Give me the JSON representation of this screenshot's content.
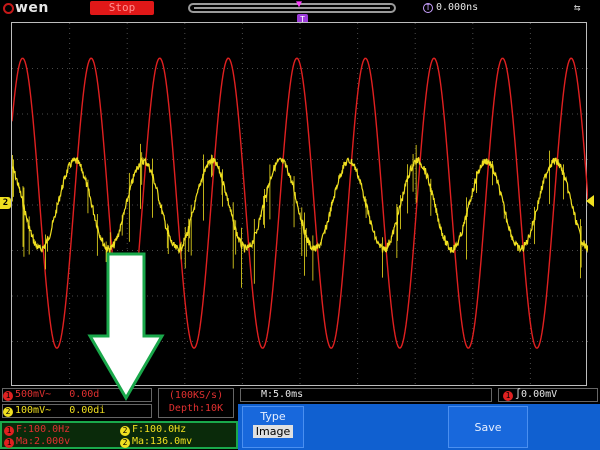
{
  "header": {
    "brand": "wen",
    "run_state": "Stop",
    "trigger_marker": "T",
    "delay_icon": "T",
    "time_delay": "0.000ns",
    "usb_icon": "usb-icon"
  },
  "markers": {
    "ch2_level": "2"
  },
  "channels": {
    "ch1": {
      "num": "1",
      "label": "500mV~",
      "position": "0.00d"
    },
    "ch2": {
      "num": "2",
      "label": "100mV~",
      "position": "0.00di"
    }
  },
  "sample": {
    "rate": "(100KS/s)",
    "depth": "Depth:10K"
  },
  "timebase": "M:5.0ms",
  "trigger": {
    "num": "1",
    "slope": "∫",
    "level": "0.00mV"
  },
  "measurements": {
    "ch1_freq": "F:100.0Hz",
    "ch1_amp": "Ma:2.000v",
    "ch2_freq": "F:100.0Hz",
    "ch2_amp": "Ma:136.0mv",
    "ch1_num": "1",
    "ch2_num": "2"
  },
  "menu": {
    "type_label": "Type",
    "type_value": "Image",
    "save_label": "Save"
  },
  "colors": {
    "ch1": "#e02020",
    "ch2": "#f0e020",
    "menu": "#1060d0",
    "highlight": "#1aa84b"
  }
}
